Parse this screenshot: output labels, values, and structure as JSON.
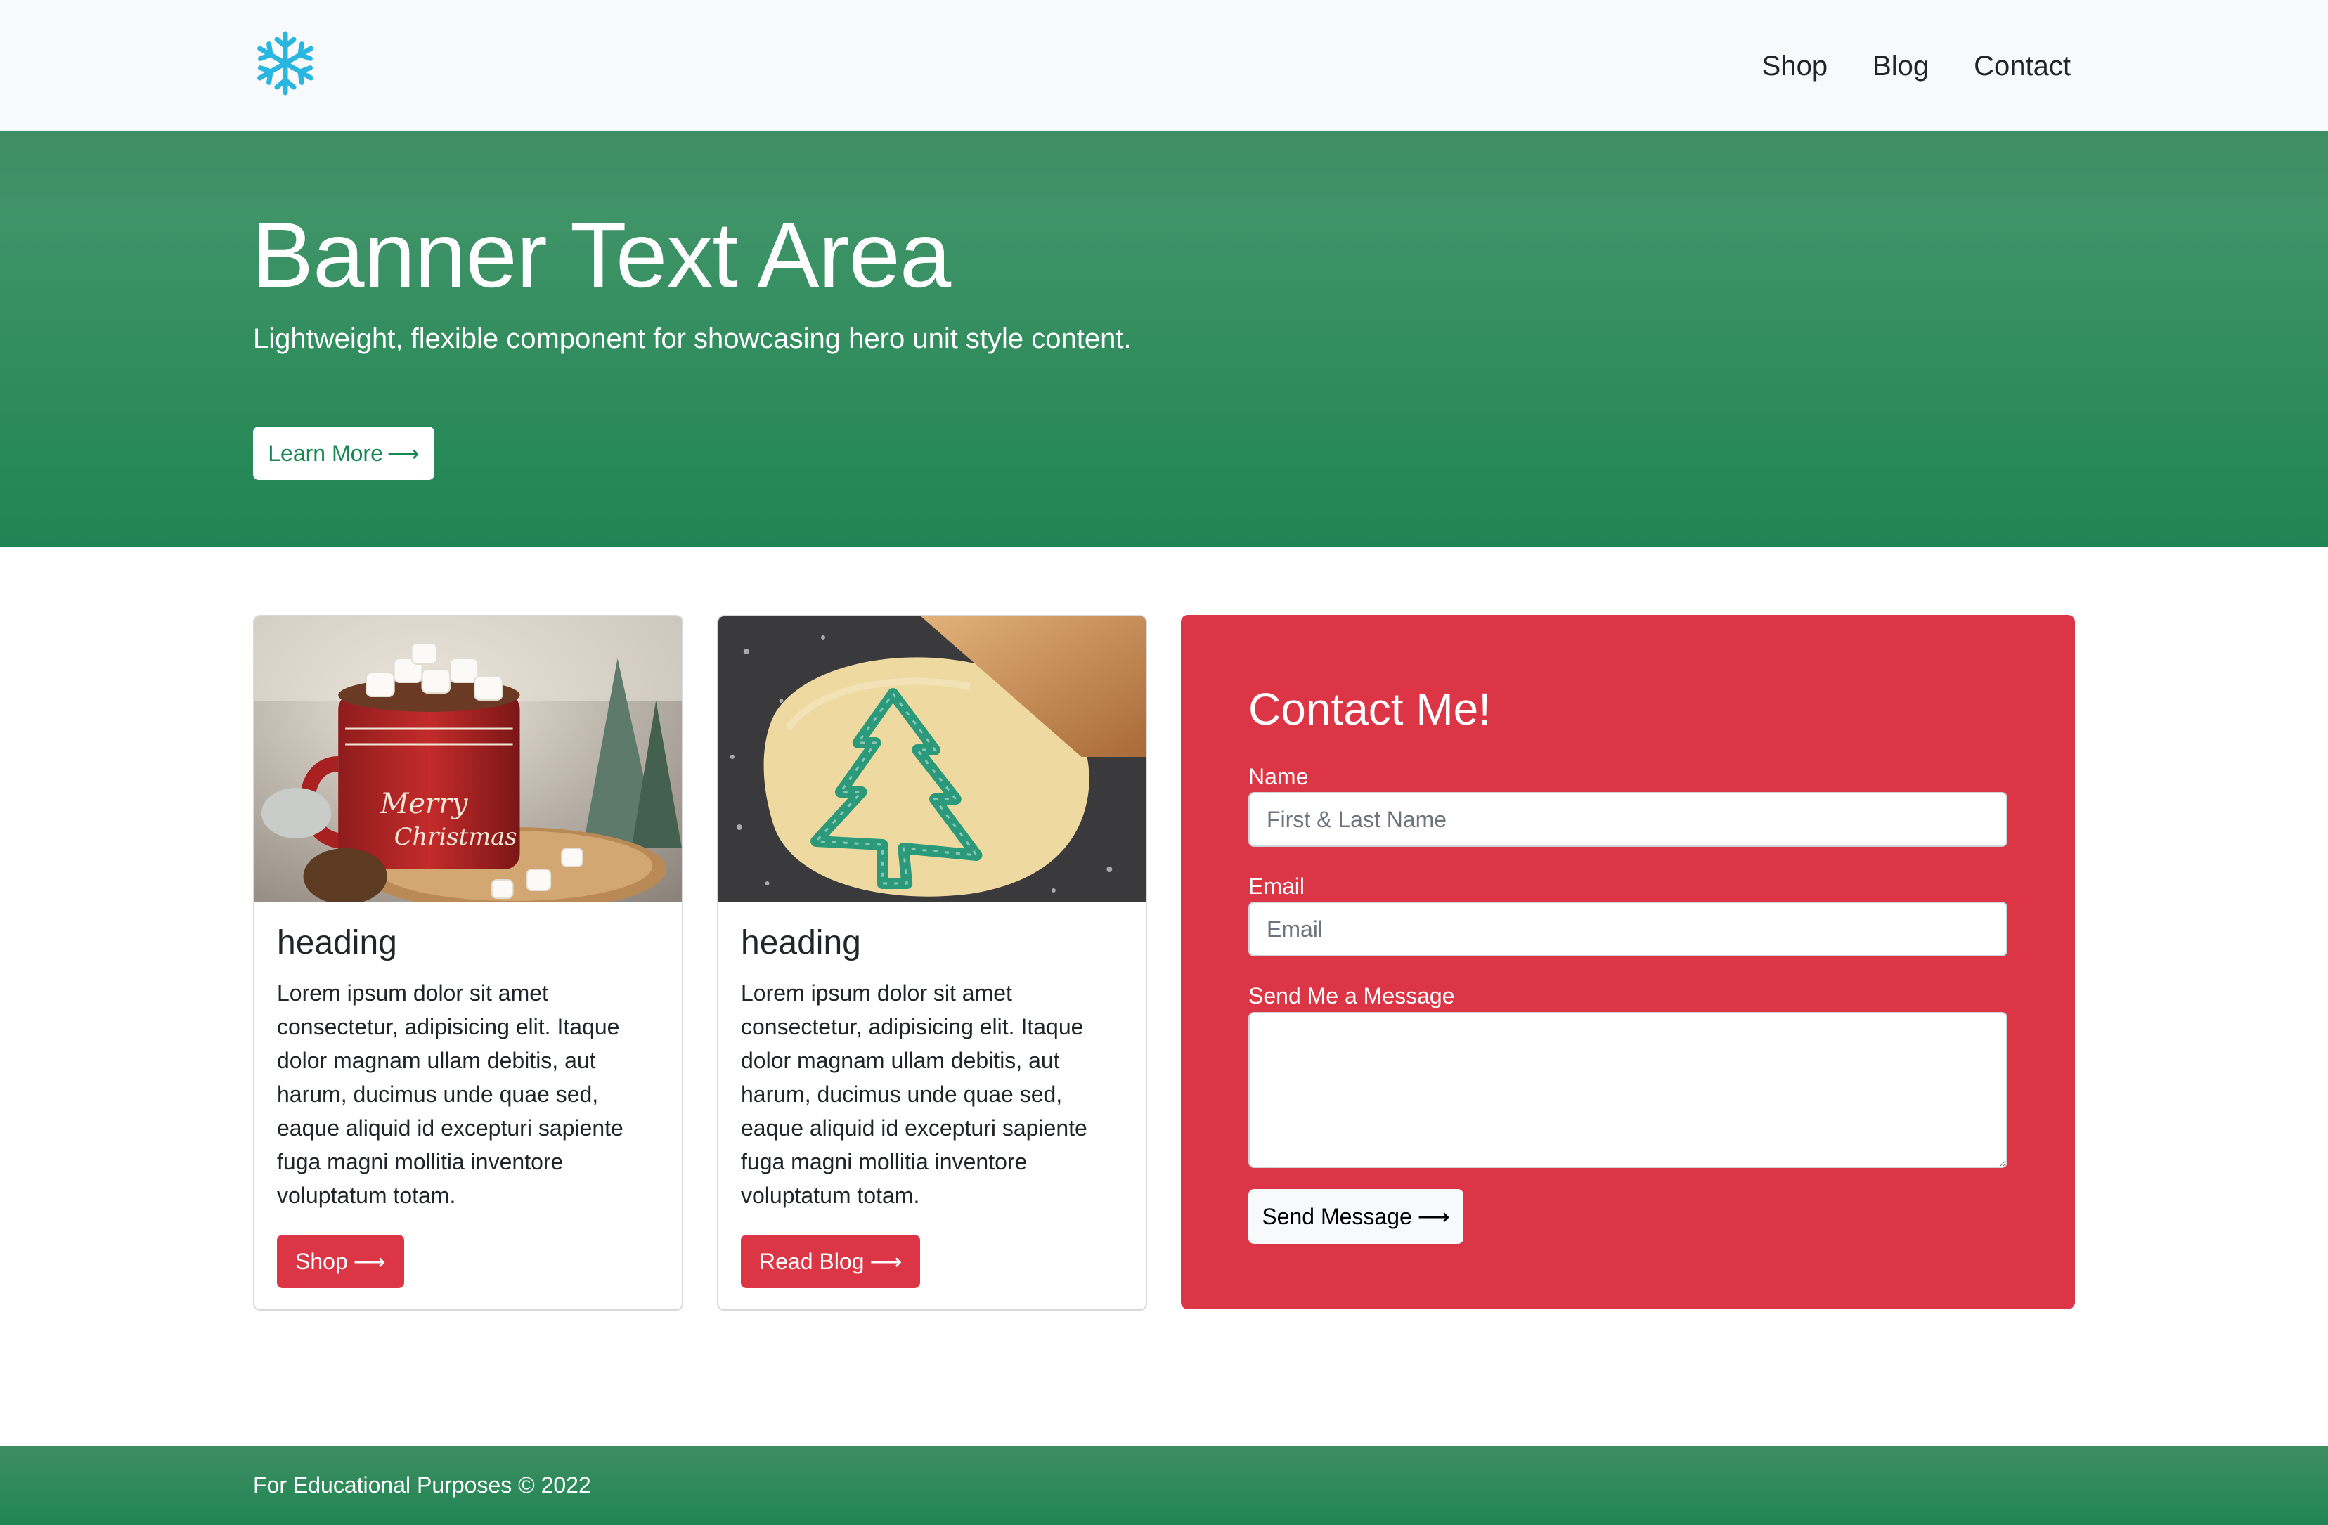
{
  "navbar": {
    "brand_icon": "snowflake-icon",
    "brand_color": "#29b6e0",
    "links": [
      "Shop",
      "Blog",
      "Contact"
    ]
  },
  "hero": {
    "title": "Banner Text Area",
    "subtitle": "Lightweight, flexible component for showcasing hero unit style content.",
    "button_label": "Learn More",
    "button_icon": "arrow-right-icon"
  },
  "cards": [
    {
      "image": "hot-cocoa-mug-with-marshmallows",
      "heading": "heading",
      "text": "Lorem ipsum dolor sit amet consectetur, adipisicing elit. Itaque dolor magnam ullam debitis, aut harum, ducimus unde quae sed, eaque aliquid id excepturi sapiente fuga magni mollitia inventore voluptatum totam.",
      "button_label": "Shop"
    },
    {
      "image": "tree-cookie-cutter-on-dough",
      "heading": "heading",
      "text": "Lorem ipsum dolor sit amet consectetur, adipisicing elit. Itaque dolor magnam ullam debitis, aut harum, ducimus unde quae sed, eaque aliquid id excepturi sapiente fuga magni mollitia inventore voluptatum totam.",
      "button_label": "Read Blog"
    }
  ],
  "contact": {
    "title": "Contact Me!",
    "name_label": "Name",
    "name_placeholder": "First & Last Name",
    "email_label": "Email",
    "email_placeholder": "Email",
    "message_label": "Send Me a Message",
    "message_value": "",
    "submit_label": "Send Message"
  },
  "footer": {
    "text": "For Educational Purposes © 2022"
  },
  "colors": {
    "accent_red": "#dc3545",
    "hero_green": "#2f8c5c",
    "navbar_bg": "#f8f9fa"
  }
}
